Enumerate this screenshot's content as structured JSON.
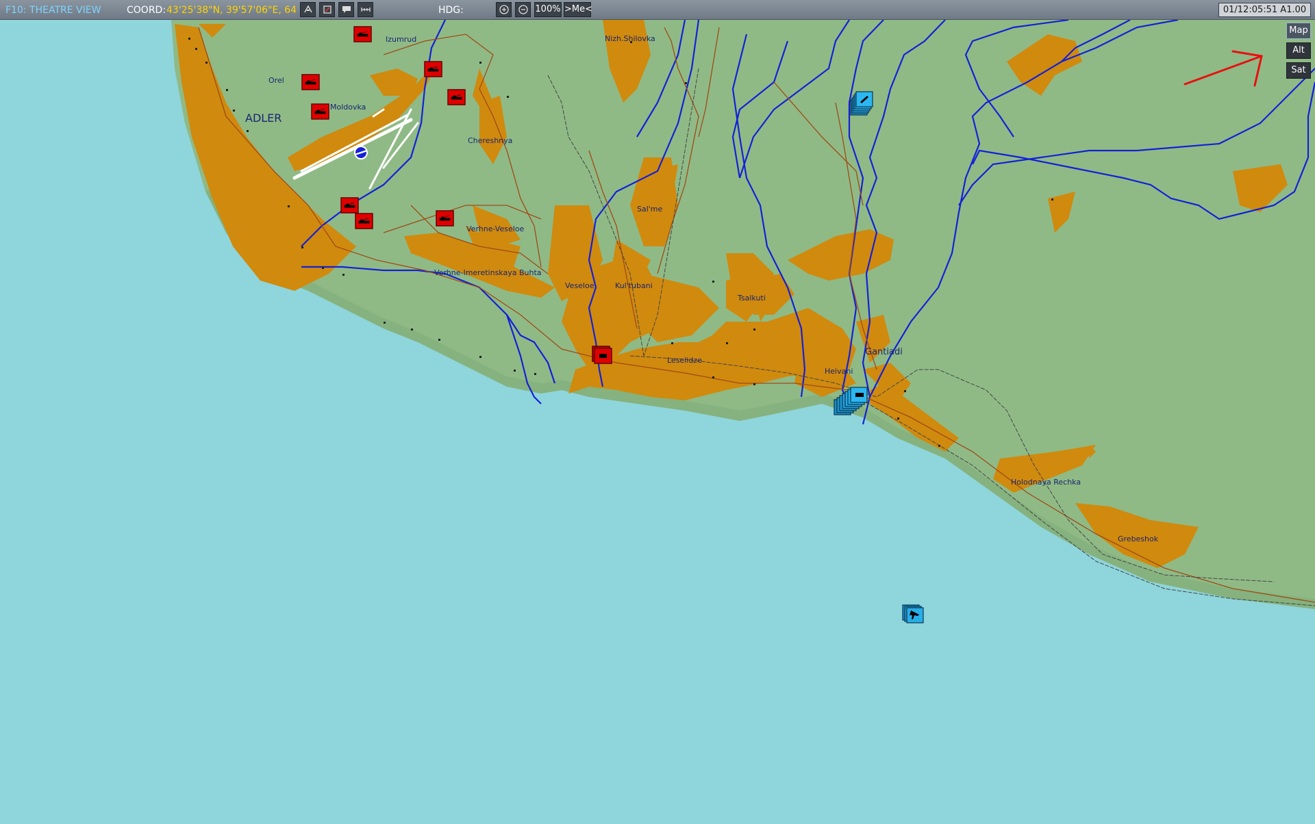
{
  "topbar": {
    "title": "F10: THEATRE VIEW",
    "coord_label": "COORD:",
    "coord_value": "43'25'38\"N, 39'57'06\"E, 64",
    "hdg_label": "HDG:",
    "zoom_value": "100%",
    "me_label": ">Me<",
    "clock": "01/12:05:51 A1.00"
  },
  "layers": {
    "map": "Map",
    "alt": "Alt",
    "sat": "Sat"
  },
  "towns": {
    "izumrud": "Izumrud",
    "nizh_shilovka": "Nizh.Shilovka",
    "orel": "Orel",
    "moldovka": "Moldovka",
    "adler": "ADLER",
    "chereshnya": "Chereshnya",
    "salme": "Sal'me",
    "verhne_veseloe": "Verhne-Veseloe",
    "imeretinskaya": "Verhne-Imeretinskaya Buhta",
    "veseloe": "Veseloe",
    "kultubani": "Kul'tubani",
    "tsalkuti": "Tsalkuti",
    "leselidze": "Leselidze",
    "heivani": "Heivani",
    "gantiadi": "Gantiadi",
    "holodnaya": "Holodnaya Rechka",
    "grebeshok": "Grebeshok"
  },
  "colors": {
    "sea": "#8fd5dc",
    "land": "#8fba86",
    "urban": "#d08a0e",
    "river": "#1420d8",
    "red_unit": "#e00000",
    "blue_unit": "#27aee8"
  }
}
